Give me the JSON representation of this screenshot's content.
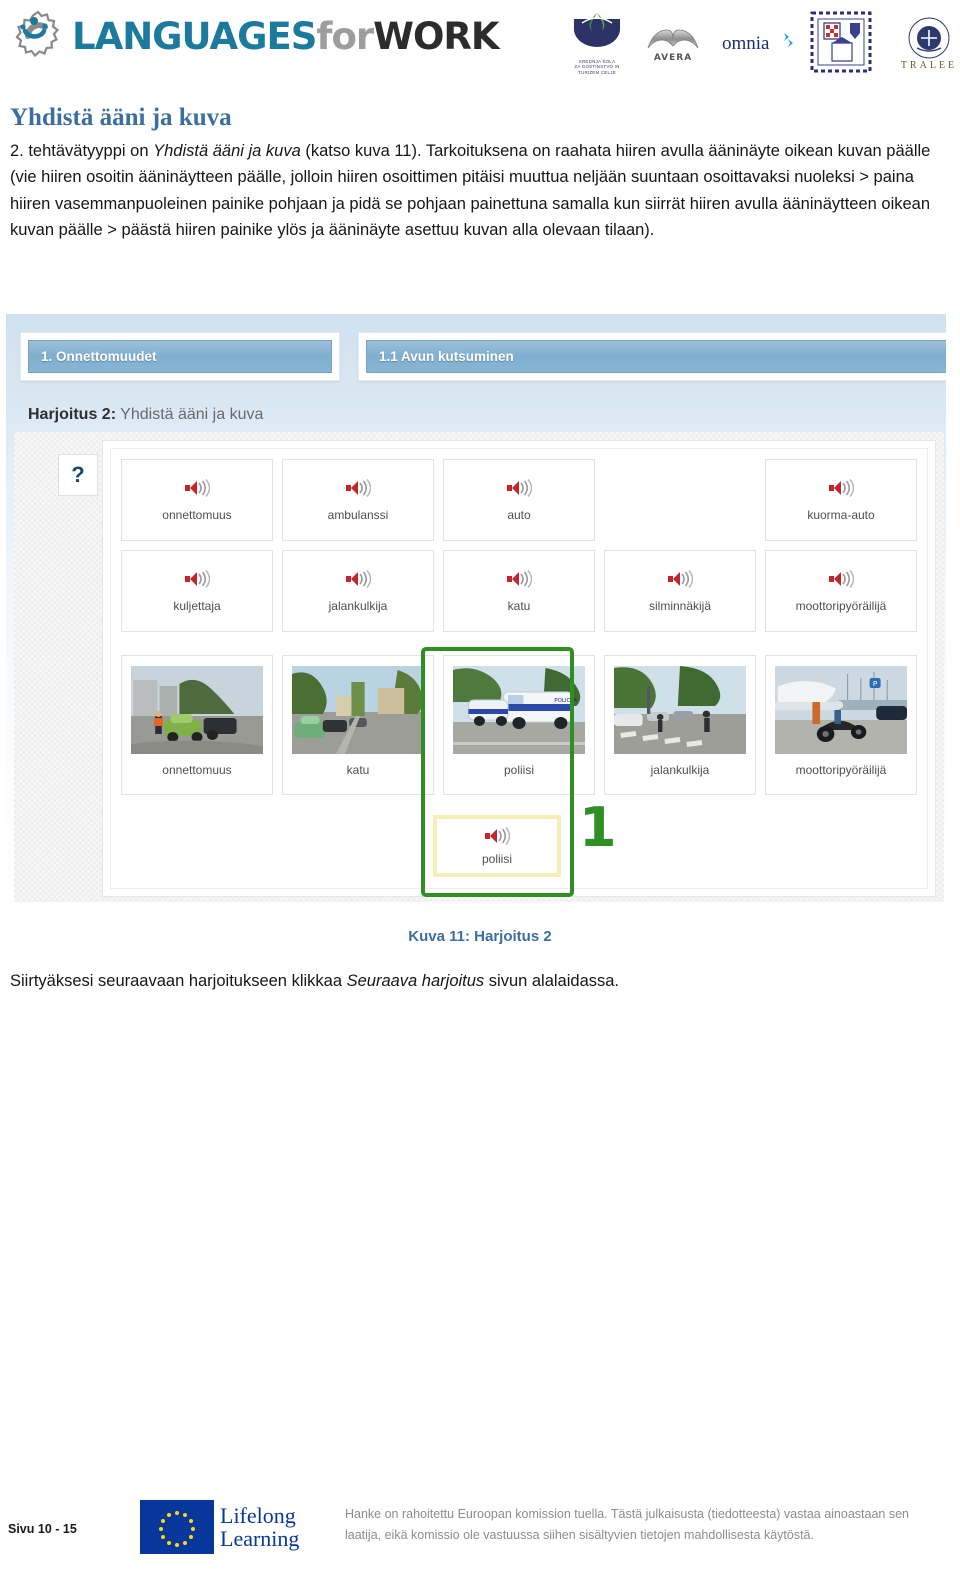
{
  "header": {
    "brand": {
      "part1": "LANGUAGES",
      "part2": "for",
      "part3": "WORK",
      "logo_icon": "gear-person-icon"
    },
    "partners": [
      {
        "name": "srednja-sola-logo",
        "caption": "SREDNJA ŠOLA\nZA GOSTINSTVO IN TURIZEM CELJE"
      },
      {
        "name": "avera-logo",
        "caption": "AVERA"
      },
      {
        "name": "omnia-logo",
        "caption": "omnia"
      },
      {
        "name": "croatia-crest-logo",
        "caption": ""
      },
      {
        "name": "tralee-logo",
        "caption": "T R A L E E"
      }
    ]
  },
  "doc": {
    "title": "Yhdistä ääni ja kuva",
    "paragraph_parts": [
      {
        "text": "2. tehtävätyyppi on ",
        "italic": false
      },
      {
        "text": "Yhdistä ääni ja kuva",
        "italic": true
      },
      {
        "text": " (katso kuva 11). Tarkoituksena on raahata hiiren avulla ääninäyte oikean kuvan päälle (vie hiiren osoitin ääninäytteen päälle, jolloin hiiren osoittimen pitäisi muuttua neljään suuntaan osoittavaksi nuoleksi > paina hiiren vasemmanpuoleinen painike pohjaan ja pidä se pohjaan painettuna samalla kun siirrät hiiren avulla ääninäytteen oikean kuvan päälle > päästä hiiren painike ylös ja ääninäyte asettuu kuvan alla olevaan tilaan).",
        "italic": false
      }
    ],
    "caption": "Kuva 11: Harjoitus 2",
    "tail_parts": [
      {
        "text": "Siirtyäksesi seuraavaan harjoitukseen klikkaa ",
        "italic": false
      },
      {
        "text": "Seuraava harjoitus",
        "italic": true
      },
      {
        "text": " sivun alalaidassa.",
        "italic": false
      }
    ]
  },
  "screenshot": {
    "tabs": [
      {
        "label": "1. Onnettomuudet"
      },
      {
        "label": "1.1 Avun kutsuminen"
      }
    ],
    "exercise_title_bold": "Harjoitus 2:",
    "exercise_title_rest": " Yhdistä ääni ja kuva",
    "help_button": "?",
    "audio_cards": [
      {
        "label": "onnettomuus",
        "empty": false
      },
      {
        "label": "ambulanssi",
        "empty": false
      },
      {
        "label": "auto",
        "empty": false
      },
      {
        "label": "",
        "empty": true
      },
      {
        "label": "kuorma-auto",
        "empty": false
      },
      {
        "label": "kuljettaja",
        "empty": false
      },
      {
        "label": "jalankulkija",
        "empty": false
      },
      {
        "label": "katu",
        "empty": false
      },
      {
        "label": "silminnäkijä",
        "empty": false
      },
      {
        "label": "moottoripyöräilijä",
        "empty": false
      }
    ],
    "image_cards": [
      {
        "label": "onnettomuus",
        "scene": "car-crash"
      },
      {
        "label": "katu",
        "scene": "street"
      },
      {
        "label": "poliisi",
        "scene": "police-vans"
      },
      {
        "label": "jalankulkija",
        "scene": "pedestrian-crossing"
      },
      {
        "label": "moottoripyöräilijä",
        "scene": "scooter-harbour"
      }
    ],
    "dropped_audio": {
      "label": "poliisi"
    },
    "annotation_number": "1",
    "colors": {
      "highlight_drop": "#2f8f22",
      "dropped_border": "#f7edb6",
      "tab_blue": "#7faecf",
      "speaker_red": "#c4242b"
    }
  },
  "footer": {
    "page": "Sivu 10 - 15",
    "logo_line1": "Lifelong",
    "logo_line2": "Learning",
    "disclaimer": "Hanke on rahoitettu Euroopan komission tuella. Tästä julkaisusta (tiedotteesta) vastaa ainoastaan sen laatija, eikä komissio ole vastuussa siihen sisältyvien tietojen mahdollisesta käytöstä."
  }
}
